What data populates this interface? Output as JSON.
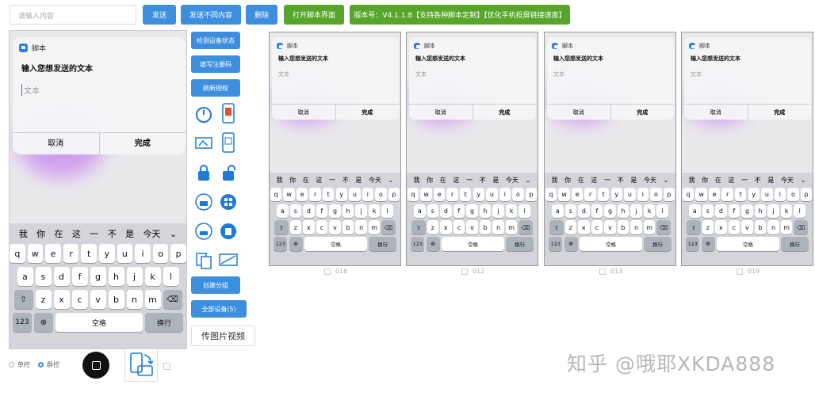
{
  "toolbar": {
    "input_placeholder": "请输入内容",
    "send": "发送",
    "send_diff": "发送不同内容",
    "delete": "删除",
    "open_script": "打开脚本界面",
    "version": "版本号：V4.1.1.8【支持各种脚本定制】【优化手机投屏链接速度】"
  },
  "main_dialog": {
    "app_name": "脚本",
    "title": "输入您想发送的文本",
    "input_placeholder": "文本",
    "cancel": "取消",
    "done": "完成"
  },
  "keyboard": {
    "candidates": [
      "我",
      "你",
      "在",
      "这",
      "一",
      "不",
      "是",
      "今天"
    ],
    "row1": [
      "q",
      "w",
      "e",
      "r",
      "t",
      "y",
      "u",
      "i",
      "o",
      "p"
    ],
    "row2": [
      "a",
      "s",
      "d",
      "f",
      "g",
      "h",
      "j",
      "k",
      "l"
    ],
    "row3": [
      "z",
      "x",
      "c",
      "v",
      "b",
      "n",
      "m"
    ],
    "num": "123",
    "space": "空格",
    "enter": "换行",
    "collapse": "⌄"
  },
  "side": {
    "detect": "检测设备状态",
    "register": "填写注册码",
    "refresh": "刷新授权",
    "create_group": "创建分组",
    "all_devices": "全部设备(5)",
    "upload": "传图片视频"
  },
  "mode": {
    "single": "单控",
    "group": "群控"
  },
  "devices": [
    {
      "id": "016"
    },
    {
      "id": "012"
    },
    {
      "id": "013"
    },
    {
      "id": "019"
    }
  ],
  "watermark": "知乎 @哦耶XKDA888",
  "colors": {
    "primary": "#3d8fde",
    "green": "#57a62b"
  }
}
